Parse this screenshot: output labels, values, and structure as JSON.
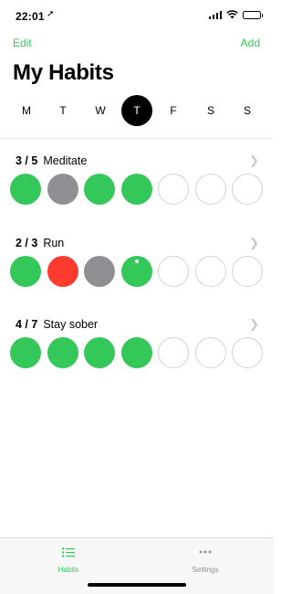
{
  "status_bar": {
    "time": "22:01",
    "location_icon": "location-arrow-icon",
    "signal_icon": "cellular-signal-icon",
    "wifi_icon": "wifi-icon",
    "battery_icon": "battery-icon"
  },
  "nav": {
    "edit_label": "Edit",
    "add_label": "Add"
  },
  "title": "My Habits",
  "days": [
    {
      "label": "M",
      "selected": false
    },
    {
      "label": "T",
      "selected": false
    },
    {
      "label": "W",
      "selected": false
    },
    {
      "label": "T",
      "selected": true
    },
    {
      "label": "F",
      "selected": false
    },
    {
      "label": "S",
      "selected": false
    },
    {
      "label": "S",
      "selected": false
    }
  ],
  "habits": [
    {
      "count": "3 / 5",
      "name": "Meditate",
      "days": [
        "done",
        "skip",
        "done",
        "done",
        "empty",
        "empty",
        "empty"
      ]
    },
    {
      "count": "2 / 3",
      "name": "Run",
      "days": [
        "done",
        "fail",
        "skip",
        "done-today",
        "empty",
        "empty",
        "empty"
      ]
    },
    {
      "count": "4 / 7",
      "name": "Stay sober",
      "days": [
        "done",
        "done",
        "done",
        "done",
        "empty",
        "empty",
        "empty"
      ]
    }
  ],
  "tabbar": {
    "habits_label": "Habits",
    "habits_icon": "list-icon",
    "settings_label": "Settings",
    "settings_icon": "ellipsis-icon"
  },
  "colors": {
    "accent": "#34c759",
    "done": "#34c759",
    "skip": "#8e8e93",
    "fail": "#ff3b30",
    "empty_border": "#d1d1d6"
  }
}
